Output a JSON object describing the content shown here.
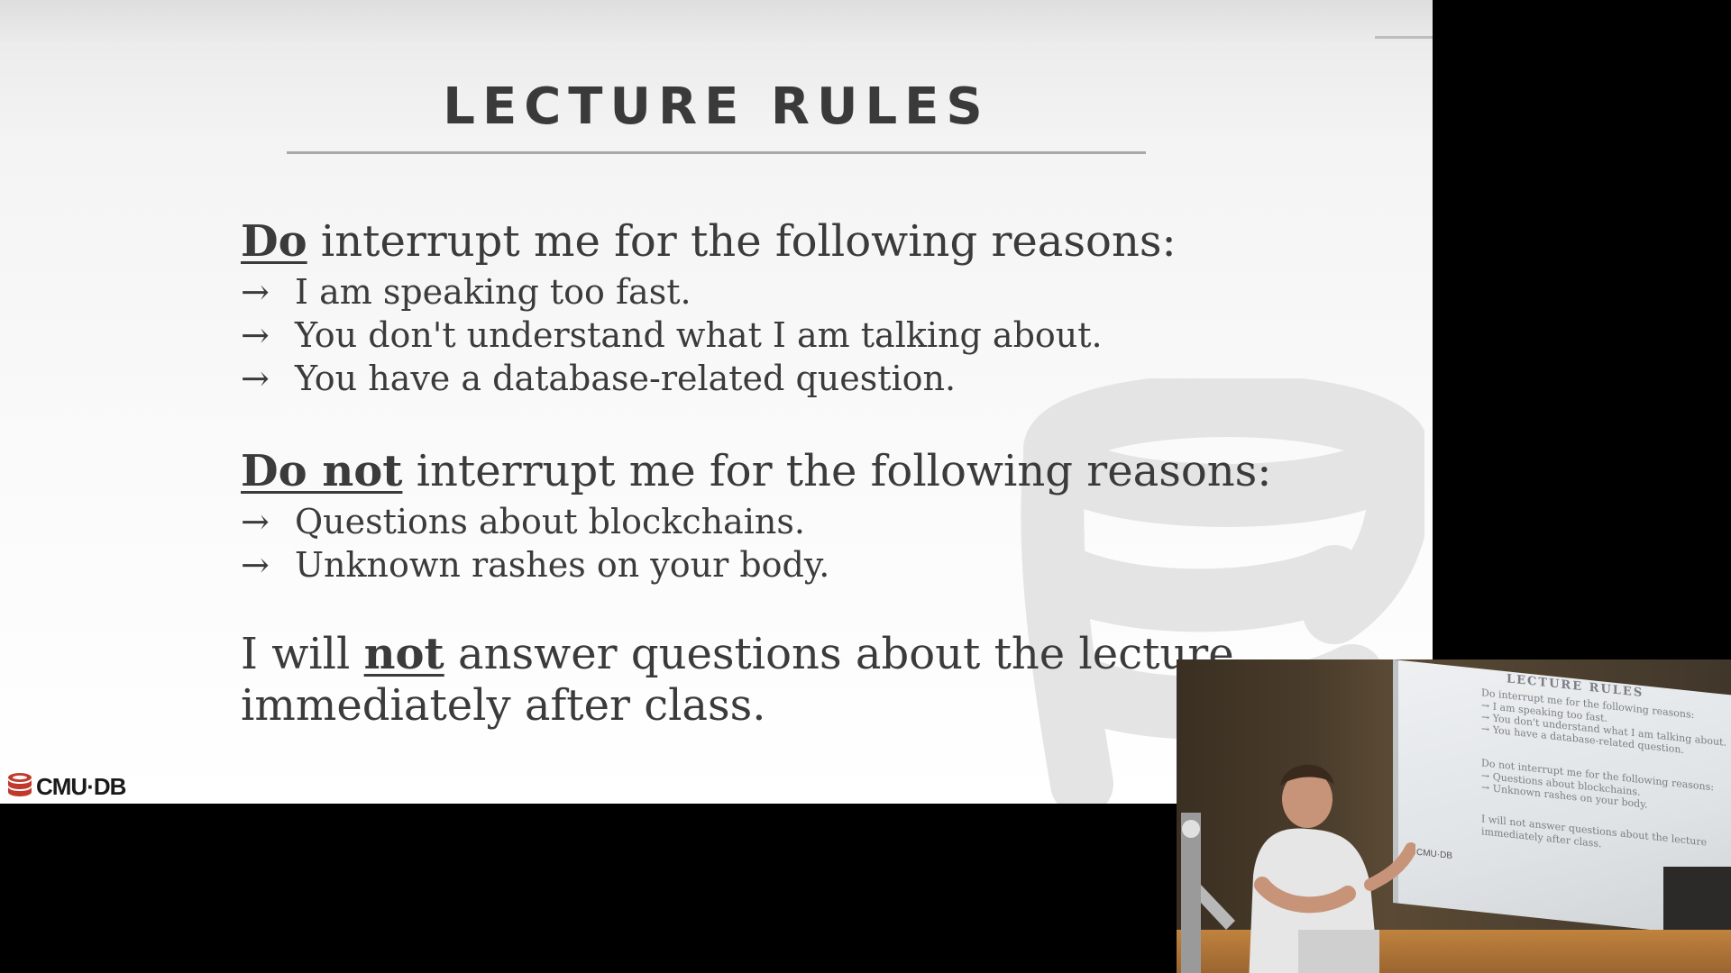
{
  "slide": {
    "title": "LECTURE RULES",
    "section_do": {
      "emphasis": "Do",
      "rest": " interrupt me for the following reasons:",
      "bullets": [
        "I am speaking too fast.",
        "You don't understand what I am talking about.",
        "You have a database-related question."
      ]
    },
    "section_do_not": {
      "emphasis": "Do not",
      "rest": " interrupt me for the following reasons:",
      "bullets": [
        "Questions about blockchains.",
        "Unknown rashes on your body."
      ]
    },
    "closing": {
      "line1_prefix": "I will ",
      "line1_emphasis": "not",
      "line1_suffix": " answer questions about the lecture",
      "line2": "immediately after class."
    },
    "arrow_glyph": "→",
    "logo_text": "CMU·DB",
    "logo_icon": "database-stack-icon"
  },
  "webcam": {
    "screen_title": "LECTURE RULES",
    "screen_lines": [
      "Do interrupt me for the following reasons:",
      "→ I am speaking too fast.",
      "→ You don't understand what I am talking about.",
      "→ You have a database-related question.",
      "Do not interrupt me for the following reasons:",
      "→ Questions about blockchains.",
      "→ Unknown rashes on your body.",
      "I will not answer questions about the lecture",
      "immediately after class."
    ],
    "screen_logo": "CMU·DB"
  },
  "colors": {
    "slide_text": "#3b3b3b",
    "title_text": "#3a3a3a",
    "logo_red": "#c0392b",
    "letterbox": "#000000"
  }
}
